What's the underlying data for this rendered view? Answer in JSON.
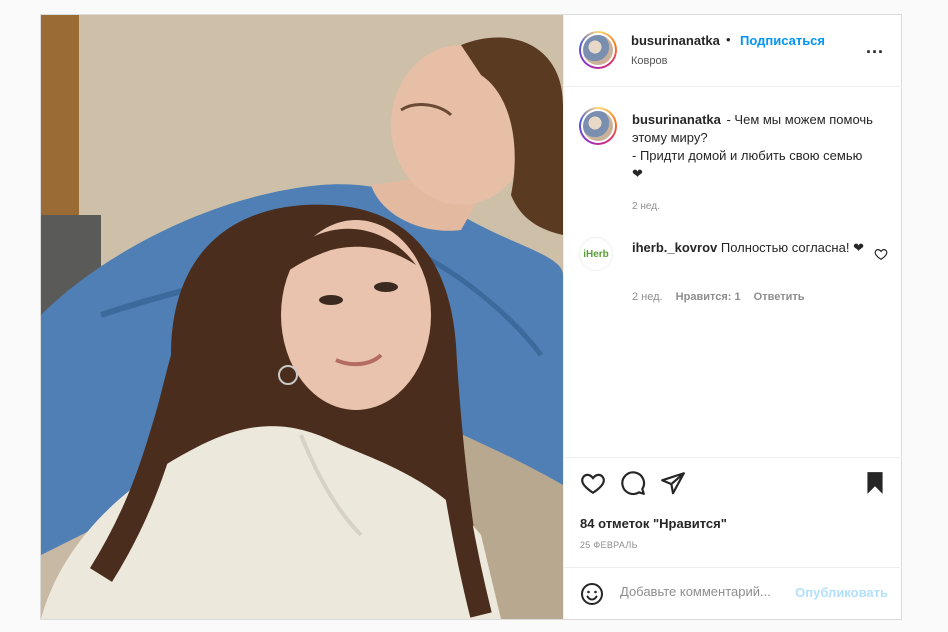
{
  "post": {
    "username": "busurinanatka",
    "separator": "•",
    "follow_label": "Подписаться",
    "location": "Ковров",
    "more_label": "...",
    "caption_lines": [
      "- Чем мы можем помочь этому миру?",
      "- Придти домой и любить свою семью",
      "❤"
    ],
    "caption_time": "2 нед.",
    "comments": [
      {
        "avatar_text": "iHerb",
        "username": "iherb._kovrov",
        "text": "Полностью согласна!",
        "heart": "❤",
        "time": "2 нед.",
        "likes": "Нравится: 1",
        "reply": "Ответить"
      }
    ],
    "likes_text": "84 отметок \"Нравится\"",
    "date": "25 ФЕВРАЛЬ",
    "comment_placeholder": "Добавьте комментарий...",
    "publish_label": "Опубликовать"
  },
  "colors": {
    "accent": "#0095f6",
    "publish_disabled": "#b2dffc",
    "border": "#dbdbdb",
    "shirt": "#4f7fb4",
    "sweater": "#ede8dc"
  },
  "icons": [
    "more-icon",
    "heart-icon",
    "comment-icon",
    "share-icon",
    "bookmark-icon",
    "emoji-icon",
    "small-heart-icon"
  ]
}
